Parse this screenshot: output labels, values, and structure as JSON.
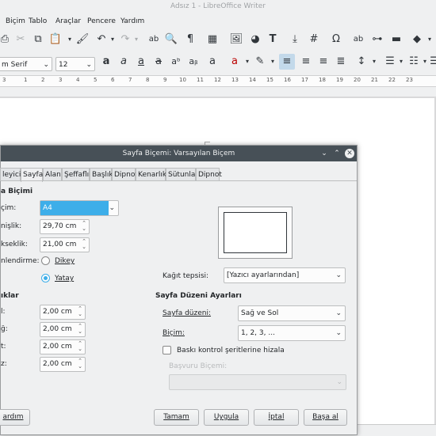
{
  "window": {
    "title": "Adsız 1 - LibreOffice Writer"
  },
  "menubar": [
    "Biçim",
    "Tablo",
    "Araçlar",
    "Pencere",
    "Yardım"
  ],
  "toolbar_format": {
    "font_name": "m Serif",
    "font_size": "12"
  },
  "ruler_ticks": [
    "3",
    "1",
    "2",
    "3",
    "4",
    "5",
    "6",
    "7",
    "8",
    "9",
    "10",
    "11",
    "12",
    "13",
    "14",
    "15",
    "16",
    "17",
    "18",
    "19",
    "20",
    "21",
    "22",
    "23"
  ],
  "dialog": {
    "title": "Sayfa Biçemi: Varsayılan Biçem",
    "tabs": [
      "leyici",
      "Sayfa",
      "Alan",
      "Şeffaflık",
      "Başlık",
      "Dipnot",
      "Kenarlık",
      "Sütunlar",
      "Dipnot"
    ],
    "active_tab": "Sayfa",
    "paper_section": "a Biçimi",
    "format_label": "çim:",
    "format_value": "A4",
    "width_label": "nişlik:",
    "width_value": "29,70 cm",
    "height_label": "kseklik:",
    "height_value": "21,00 cm",
    "orientation_label": "nlendirme:",
    "orientation_portrait": "Dikey",
    "orientation_landscape": "Yatay",
    "paper_tray_label": "Kağıt tepsisi:",
    "paper_tray_value": "[Yazıcı ayarlarından]",
    "margins_section": "ıklar",
    "margins": [
      {
        "label": "l:",
        "value": "2,00 cm"
      },
      {
        "label": "ğ:",
        "value": "2,00 cm"
      },
      {
        "label": "t:",
        "value": "2,00 cm"
      },
      {
        "label": "z:",
        "value": "2,00 cm"
      }
    ],
    "layout_section": "Sayfa Düzeni Ayarları",
    "page_layout_label": "Sayfa düzeni:",
    "page_layout_value": "Sağ ve Sol",
    "numbering_label": "Biçim:",
    "numbering_value": "1, 2, 3, ...",
    "register_checkbox": "Baskı kontrol şeritlerine hizala",
    "reference_style_label": "Başvuru Biçemi:",
    "buttons": {
      "help": "ardım",
      "ok": "Tamam",
      "apply": "Uygula",
      "cancel": "İptal",
      "reset": "Başa al"
    }
  },
  "colors": {
    "accent": "#3daee9",
    "titlebar": "#475057",
    "dialog_bg": "#eff0f1"
  }
}
